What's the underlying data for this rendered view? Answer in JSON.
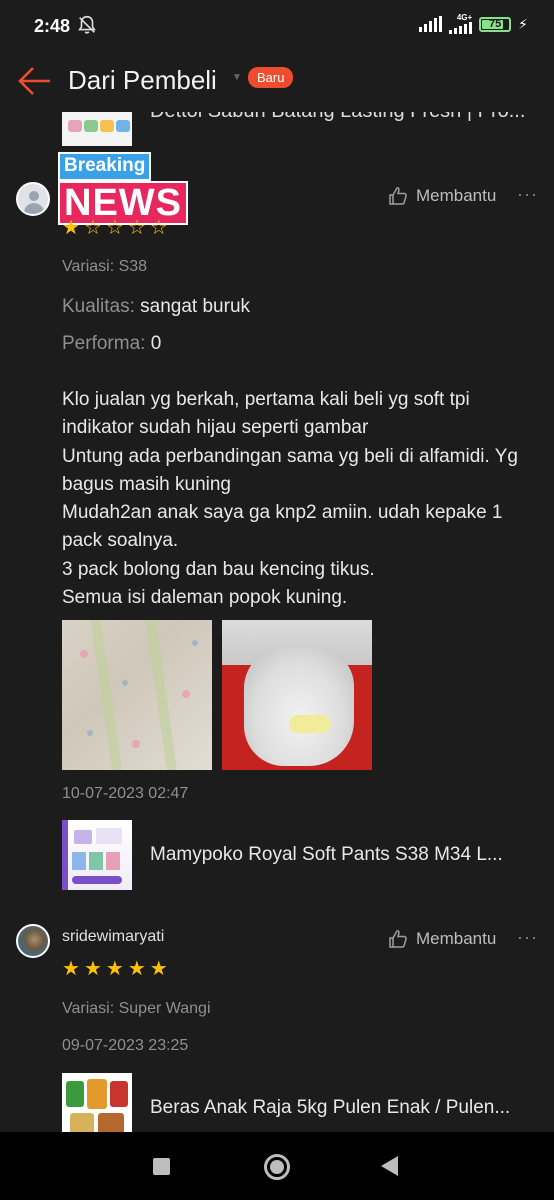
{
  "status_bar": {
    "time": "2:48",
    "network_label": "4G+",
    "battery_percent": "75",
    "battery_level": 0.75,
    "icons": [
      "do-not-disturb-icon",
      "signal-icon",
      "signal-4g-icon",
      "battery-icon",
      "charging-icon"
    ]
  },
  "header": {
    "title": "Dari Pembeli",
    "badge": "Baru",
    "back_icon": "arrow-left-icon",
    "accent_color": "#ee4d2d"
  },
  "top_product": {
    "name": "Dettol Sabun Batang Lasting Fresh | Pro..."
  },
  "reviews": [
    {
      "sticker_line1": "Breaking",
      "sticker_line2": "NEWS",
      "helpful_label": "Membantu",
      "more_label": "···",
      "rating": 1,
      "rating_max": 5,
      "variation": "Variasi: S38",
      "quality_label": "Kualitas:",
      "quality_value": "sangat buruk",
      "performance_label": "Performa:",
      "performance_value": "0",
      "text": "Klo jualan yg berkah, pertama kali beli yg soft tpi indikator sudah hijau seperti gambar\nUntung ada perbandingan sama yg beli di alfamidi. Yg bagus masih kuning\nMudah2an anak saya ga knp2 amiin. udah kepake 1 pack soalnya.\n3 pack bolong dan bau kencing tikus.\nSemua isi daleman popok kuning.",
      "date": "10-07-2023 02:47",
      "product_name": "Mamypoko Royal Soft Pants S38 M34 L..."
    },
    {
      "username": "sridewimaryati",
      "helpful_label": "Membantu",
      "more_label": "···",
      "rating": 5,
      "rating_max": 5,
      "variation": "Variasi: Super Wangi",
      "date": "09-07-2023 23:25",
      "product_name": "Beras Anak Raja 5kg Pulen Enak / Pulen..."
    }
  ],
  "nav_bar": {
    "icons": [
      "recents-square-icon",
      "home-circle-icon",
      "back-triangle-icon"
    ]
  },
  "colors": {
    "background": "#1c1c1c",
    "star": "#ffc107",
    "muted_text": "#8f8f8f"
  }
}
